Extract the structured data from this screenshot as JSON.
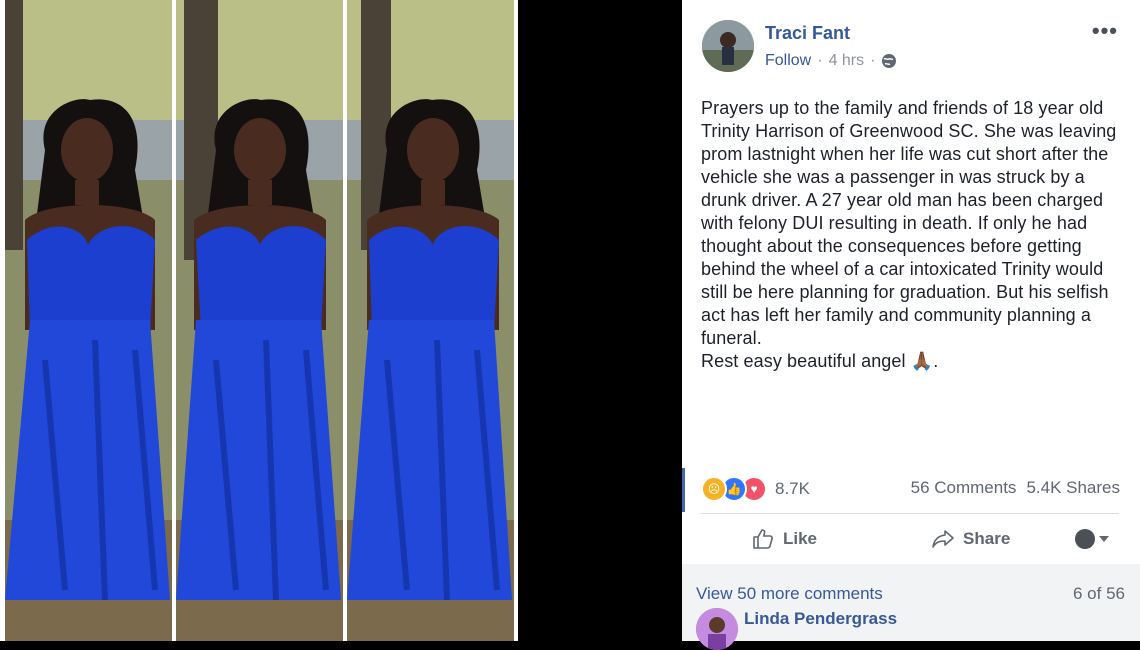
{
  "post": {
    "author": "Traci Fant",
    "follow_label": "Follow",
    "time": "4 hrs",
    "separator": "·",
    "more_label": "•••",
    "paragraph_1": "Prayers up to the family and friends of 18 year old Trinity Harrison of Greenwood SC. She was leaving prom lastnight when her life was cut short after the vehicle she was a passenger in was struck by a drunk driver. A 27 year old man has been charged with felony DUI resulting in death. If only he had thought about the consequences before getting behind the wheel of a car intoxicated Trinity would still be here planning for graduation. But his selfish act has left her family and community planning a funeral.",
    "paragraph_2": "Rest easy beautiful angel 🙏🏾."
  },
  "stats": {
    "reaction_count": "8.7K",
    "comments": "56 Comments",
    "shares": "5.4K Shares"
  },
  "actions": {
    "like_label": "Like",
    "share_label": "Share"
  },
  "comments": {
    "view_more": "View 50 more comments",
    "pager": "6 of 56",
    "first_commenter": "Linda Pendergrass"
  },
  "colors": {
    "link_blue": "#385898",
    "dress_blue": "#1d3fd0",
    "text": "#1d2129",
    "muted": "#606770"
  },
  "icons": [
    "globe-icon",
    "like-thumb-icon",
    "share-arrow-icon",
    "more-options-icon",
    "sad-reaction-icon",
    "like-reaction-icon",
    "love-reaction-icon",
    "caret-down-icon"
  ]
}
